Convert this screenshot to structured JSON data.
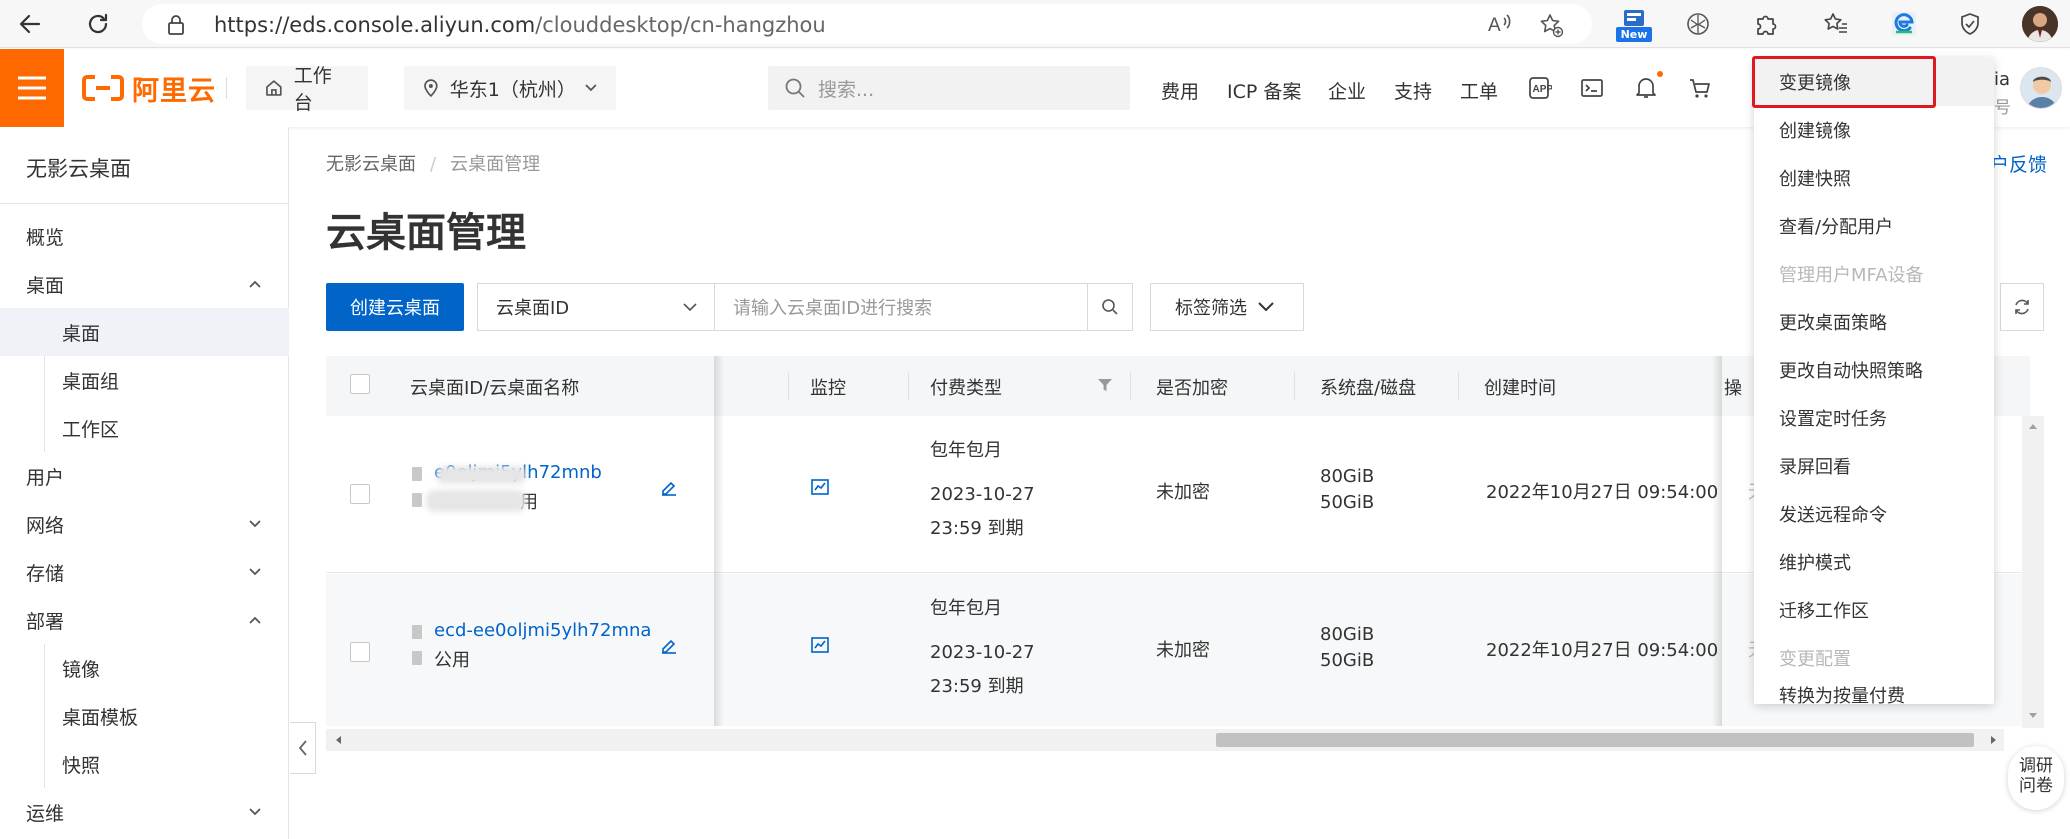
{
  "browser": {
    "url_main": "https://eds.console.aliyun.com",
    "url_path": "/clouddesktop/cn-hangzhou",
    "new_badge": "New"
  },
  "topnav": {
    "logo_text": "阿里云",
    "workbench": "工作台",
    "region": "华东1（杭州）",
    "search_placeholder": "搜索...",
    "links": [
      "费用",
      "ICP 备案",
      "企业",
      "支持",
      "工单"
    ],
    "account_name_partial": "ia",
    "account_type_partial": "号",
    "brand_color": "#ff6a00"
  },
  "sidebar": {
    "title": "无影云桌面",
    "items": [
      {
        "label": "概览"
      },
      {
        "label": "桌面"
      },
      {
        "label": "桌面"
      },
      {
        "label": "桌面组"
      },
      {
        "label": "工作区"
      },
      {
        "label": "用户"
      },
      {
        "label": "网络"
      },
      {
        "label": "存储"
      },
      {
        "label": "部署"
      },
      {
        "label": "镜像"
      },
      {
        "label": "桌面模板"
      },
      {
        "label": "快照"
      },
      {
        "label": "运维"
      }
    ]
  },
  "main": {
    "breadcrumb": [
      "无影云桌面",
      "云桌面管理"
    ],
    "title": "云桌面管理",
    "feedback": "户反馈",
    "create_button": "创建云桌面",
    "filter_select": "云桌面ID",
    "search_placeholder": "请输入云桌面ID进行搜索",
    "tag_filter": "标签筛选"
  },
  "table": {
    "columns": [
      "云桌面ID/云桌面名称",
      "监控",
      "付费类型",
      "是否加密",
      "系统盘/磁盘",
      "创建时间",
      "操"
    ],
    "rows": [
      {
        "id": "ecd-ee0oljmi5ylh72mnb",
        "id_visible": "e0oljmi5ylh72mnb",
        "name": "公用",
        "name_visible": "用",
        "billing": "包年包月",
        "expire_date": "2023-10-27",
        "expire_time": "23:59 到期",
        "encrypted": "未加密",
        "system_disk": "80GiB",
        "data_disk": "50GiB",
        "created": "2022年10月27日 09:54:00",
        "op_partial": "无"
      },
      {
        "id": "ecd-ee0oljmi5ylh72mna",
        "id_visible": "ecd-ee0oljmi5ylh72mna",
        "name": "公用",
        "name_visible": "公用",
        "billing": "包年包月",
        "expire_date": "2023-10-27",
        "expire_time": "23:59 到期",
        "encrypted": "未加密",
        "system_disk": "80GiB",
        "data_disk": "50GiB",
        "created": "2022年10月27日 09:54:00",
        "op_partial": "无"
      }
    ]
  },
  "dropdown": {
    "items": [
      {
        "label": "变更镜像",
        "disabled": false
      },
      {
        "label": "创建镜像",
        "disabled": false
      },
      {
        "label": "创建快照",
        "disabled": false
      },
      {
        "label": "查看/分配用户",
        "disabled": false
      },
      {
        "label": "管理用户MFA设备",
        "disabled": true
      },
      {
        "label": "更改桌面策略",
        "disabled": false
      },
      {
        "label": "更改自动快照策略",
        "disabled": false
      },
      {
        "label": "设置定时任务",
        "disabled": false
      },
      {
        "label": "录屏回看",
        "disabled": false
      },
      {
        "label": "发送远程命令",
        "disabled": false
      },
      {
        "label": "维护模式",
        "disabled": false
      },
      {
        "label": "迁移工作区",
        "disabled": false
      },
      {
        "label": "变更配置",
        "disabled": true
      },
      {
        "label": "转换为按量付费",
        "disabled": false
      }
    ],
    "highlight_color": "#e0191e"
  },
  "survey": {
    "line1": "调研",
    "line2": "问卷"
  }
}
